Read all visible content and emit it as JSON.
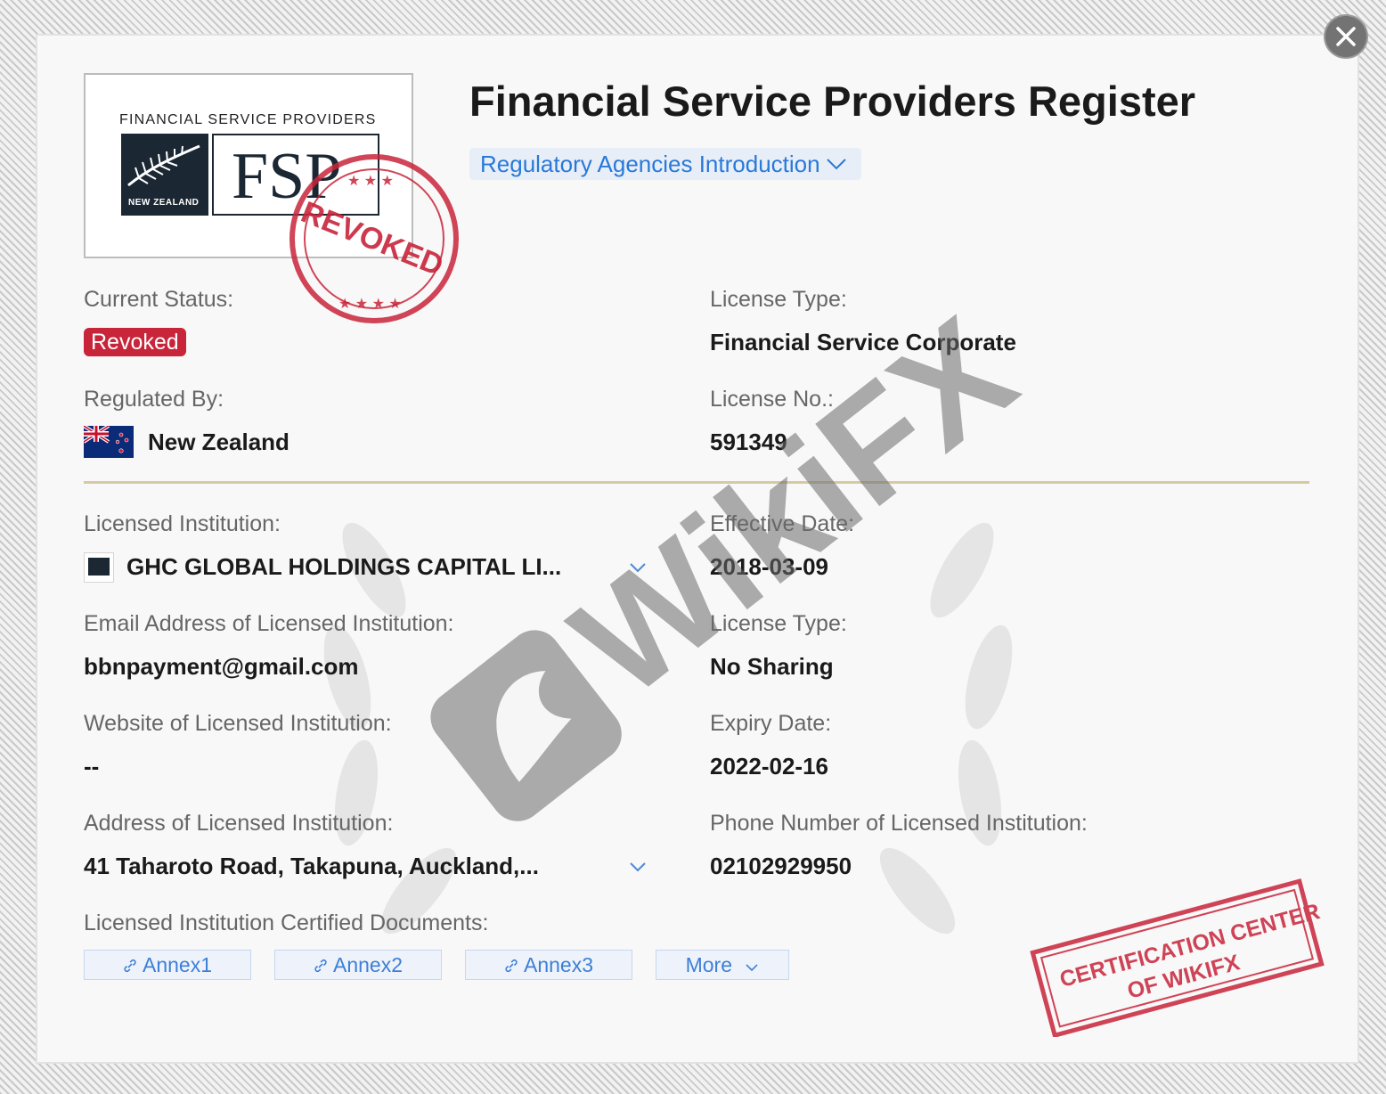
{
  "dialog": {
    "title": "Financial Service Providers Register",
    "agencies_label": "Regulatory Agencies Introduction",
    "close_icon": "close-icon"
  },
  "logo": {
    "caption": "FINANCIAL SERVICE PROVIDERS",
    "fern_text": "NEW ZEALAND",
    "mark_text": "FSP",
    "revoked_stamp": "REVOKED"
  },
  "fields": {
    "current_status_label": "Current Status:",
    "current_status_value": "Revoked",
    "license_type_label": "License Type:",
    "license_type_value": "Financial Service Corporate",
    "regulated_by_label": "Regulated By:",
    "regulated_by_value": "New Zealand",
    "license_no_label": "License No.:",
    "license_no_value": "591349",
    "licensed_institution_label": "Licensed Institution:",
    "licensed_institution_value": "GHC GLOBAL HOLDINGS CAPITAL LI...",
    "effective_date_label": "Effective Date:",
    "effective_date_value": "2018-03-09",
    "email_label": "Email Address of Licensed Institution:",
    "email_value": "bbnpayment@gmail.com",
    "license_type2_label": "License Type:",
    "license_type2_value": "No Sharing",
    "website_label": "Website of Licensed Institution:",
    "website_value": "--",
    "expiry_date_label": "Expiry Date:",
    "expiry_date_value": "2022-02-16",
    "address_label": "Address of Licensed Institution:",
    "address_value": "41 Taharoto Road, Takapuna, Auckland,...",
    "phone_label": "Phone Number of Licensed Institution:",
    "phone_value": "02102929950",
    "documents_label": "Licensed Institution Certified Documents:"
  },
  "documents": {
    "annex1": "Annex1",
    "annex2": "Annex2",
    "annex3": "Annex3",
    "more": "More"
  },
  "watermark": {
    "text": "WikiFX",
    "cert_line1": "CERTIFICATION CENTER",
    "cert_line2": "OF WIKIFX"
  },
  "colors": {
    "accent_blue": "#2979d8",
    "revoked_red": "#c8243a",
    "divider_gold": "#d7c9a2"
  }
}
